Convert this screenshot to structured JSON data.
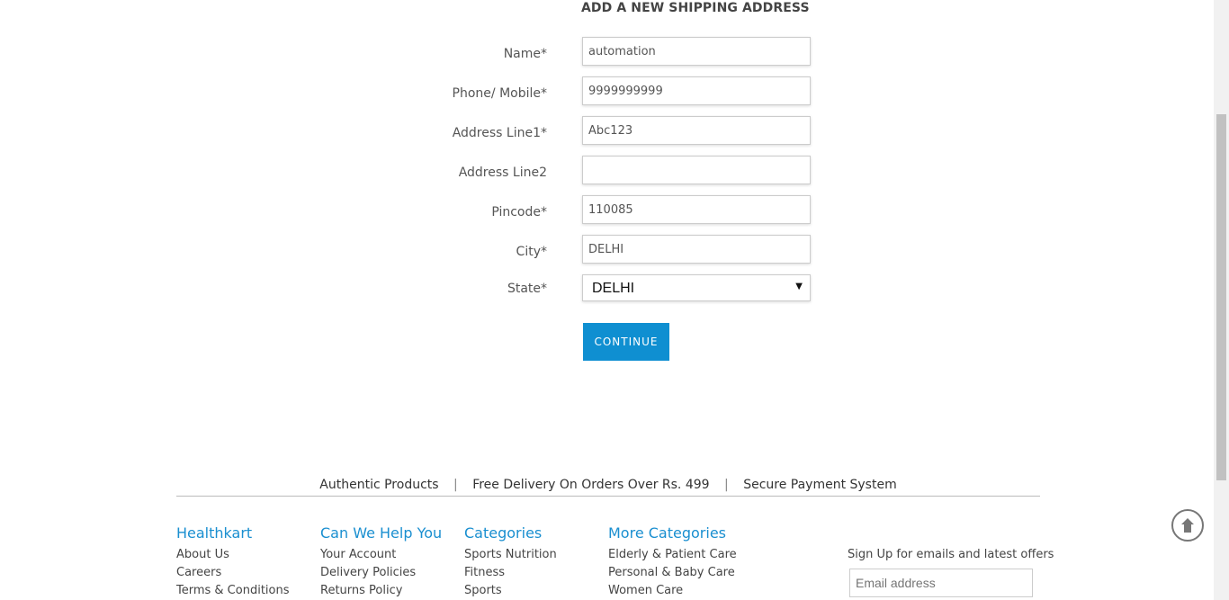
{
  "form": {
    "title": "ADD A NEW SHIPPING ADDRESS",
    "fields": [
      {
        "label": "Name*",
        "value": "automation"
      },
      {
        "label": "Phone/ Mobile*",
        "value": "9999999999"
      },
      {
        "label": "Address Line1*",
        "value": "Abc123"
      },
      {
        "label": "Address Line2",
        "value": ""
      },
      {
        "label": "Pincode*",
        "value": "110085"
      },
      {
        "label": "City*",
        "value": "DELHI"
      }
    ],
    "state": {
      "label": "State*",
      "value": "DELHI"
    },
    "continue_label": "CONTINUE"
  },
  "features": [
    "Authentic Products",
    "Free Delivery On Orders Over Rs. 499",
    "Secure Payment System"
  ],
  "feature_separator": "|",
  "footer": {
    "columns": [
      {
        "heading": "Healthkart",
        "links": [
          "About Us",
          "Careers",
          "Terms & Conditions"
        ]
      },
      {
        "heading": "Can We Help You",
        "links": [
          "Your Account",
          "Delivery Policies",
          "Returns Policy"
        ]
      },
      {
        "heading": "Categories",
        "links": [
          "Sports Nutrition",
          "Fitness",
          "Sports"
        ]
      },
      {
        "heading": "More Categories",
        "links": [
          "Elderly & Patient Care",
          "Personal & Baby Care",
          "Women Care"
        ]
      }
    ],
    "signup_text": "Sign Up for emails and latest offers",
    "email_placeholder": "Email address"
  },
  "colors": {
    "accent": "#0f8fd1",
    "heading": "#1a8fd0"
  },
  "icons": {
    "scroll_top": "arrow-up-circle-icon",
    "select_arrow": "triangle-down-icon"
  }
}
